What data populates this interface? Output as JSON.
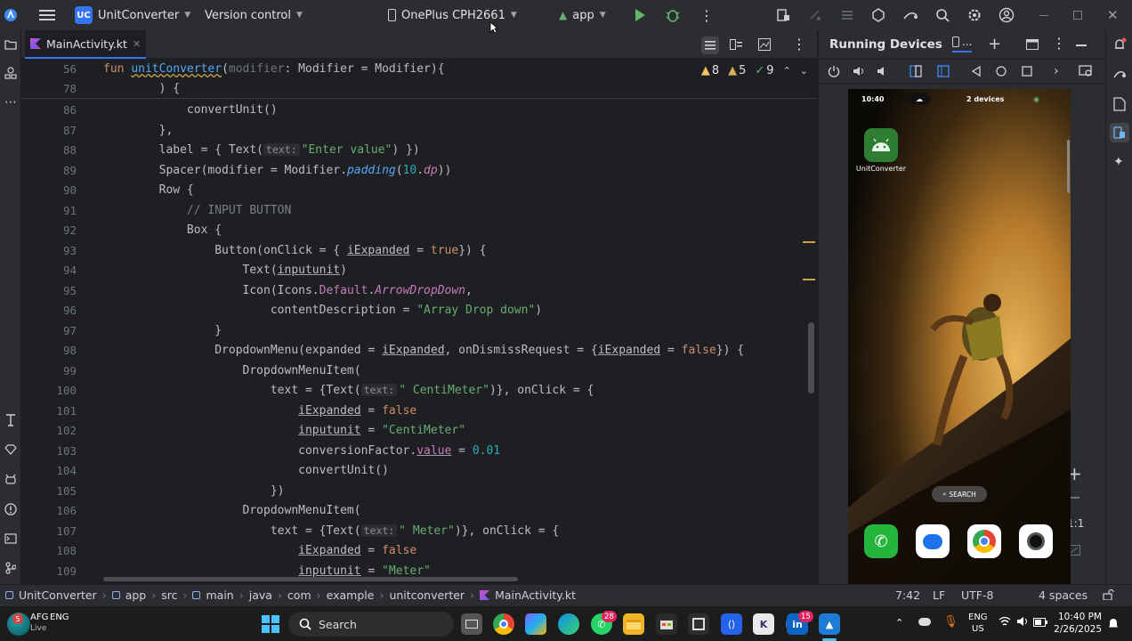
{
  "titlebar": {
    "project_badge": "UC",
    "project_name": "UnitConverter",
    "vcs": "Version control",
    "device": "OnePlus CPH2661",
    "run_config": "app"
  },
  "tab": {
    "filename": "MainActivity.kt"
  },
  "inspections": {
    "warnings_a": "8",
    "warnings_b": "5",
    "ok": "9"
  },
  "code": {
    "sticky": [
      {
        "n": "56",
        "t": "fun unitConverter(modifier: Modifier = Modifier){"
      },
      {
        "n": "78",
        "t": "    ) {"
      }
    ],
    "lines": [
      {
        "n": "86",
        "t": "        convertUnit()"
      },
      {
        "n": "87",
        "t": "    },"
      },
      {
        "n": "88",
        "t": "    label = { Text(text: \"Enter value\") })"
      },
      {
        "n": "89",
        "t": "    Spacer(modifier = Modifier.padding(10.dp))"
      },
      {
        "n": "90",
        "t": "    Row {"
      },
      {
        "n": "91",
        "t": "        // INPUT BUTTON"
      },
      {
        "n": "92",
        "t": "        Box {"
      },
      {
        "n": "93",
        "t": "            Button(onClick = { iExpanded = true}) {"
      },
      {
        "n": "94",
        "t": "                Text(inputunit)"
      },
      {
        "n": "95",
        "t": "                Icon(Icons.Default.ArrowDropDown,"
      },
      {
        "n": "96",
        "t": "                    contentDescription = \"Array Drop down\")"
      },
      {
        "n": "97",
        "t": "            }"
      },
      {
        "n": "98",
        "t": "            DropdownMenu(expanded = iExpanded, onDismissRequest = {iExpanded = false}) {"
      },
      {
        "n": "99",
        "t": "                DropdownMenuItem("
      },
      {
        "n": "100",
        "t": "                    text = {Text(text: \" CentiMeter\")}, onClick = {"
      },
      {
        "n": "101",
        "t": "                        iExpanded = false"
      },
      {
        "n": "102",
        "t": "                        inputunit = \"CentiMeter\""
      },
      {
        "n": "103",
        "t": "                        conversionFactor.value = 0.01"
      },
      {
        "n": "104",
        "t": "                        convertUnit()"
      },
      {
        "n": "105",
        "t": "                    })"
      },
      {
        "n": "106",
        "t": "                DropdownMenuItem("
      },
      {
        "n": "107",
        "t": "                    text = {Text(text: \" Meter\")}, onClick = {"
      },
      {
        "n": "108",
        "t": "                        iExpanded = false"
      },
      {
        "n": "109",
        "t": "                        inputunit = \"Meter\""
      }
    ]
  },
  "running_devices": {
    "title": "Running Devices",
    "tab_label": "...",
    "phone": {
      "time": "10:40",
      "devices": "2 devices",
      "app_label": "UnitConverter",
      "search": "SEARCH",
      "zoom": "1:1"
    }
  },
  "statusbar": {
    "breadcrumb": [
      "UnitConverter",
      "app",
      "src",
      "main",
      "java",
      "com",
      "example",
      "unitconverter",
      "MainActivity.kt"
    ],
    "position": "7:42",
    "line_sep": "LF",
    "encoding": "UTF-8",
    "indent": "4 spaces"
  },
  "taskbar": {
    "weather_temp": "AFG",
    "weather_sub": "Live",
    "weather_lang": "ENG",
    "search": "Search",
    "badge_whatsapp": "28",
    "badge_linkedin": "15",
    "lang_top": "ENG",
    "lang_bottom": "US",
    "time": "10:40 PM",
    "date": "2/26/2025"
  },
  "colors": {
    "accent": "#3574f0",
    "bg": "#1e1f22",
    "panel": "#2b2d30"
  }
}
